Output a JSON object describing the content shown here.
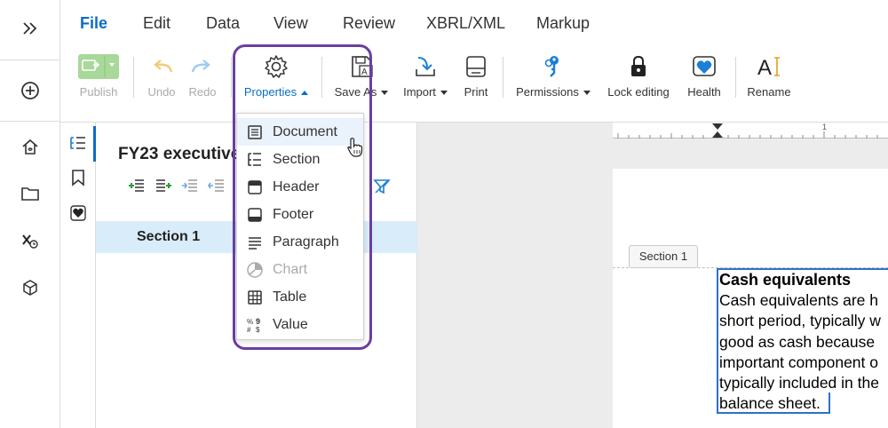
{
  "menu": [
    "File",
    "Edit",
    "Data",
    "View",
    "Review",
    "XBRL/XML",
    "Markup"
  ],
  "active_menu": "File",
  "toolbar": {
    "publish": "Publish",
    "undo": "Undo",
    "redo": "Redo",
    "properties": "Properties",
    "save_as": "Save As",
    "import": "Import",
    "print": "Print",
    "permissions": "Permissions",
    "lock_editing": "Lock editing",
    "health": "Health",
    "rename": "Rename"
  },
  "outline": {
    "title": "FY23 executive",
    "section": "Section 1"
  },
  "properties_menu": {
    "items": [
      "Document",
      "Section",
      "Header",
      "Footer",
      "Paragraph",
      "Chart",
      "Table",
      "Value"
    ],
    "disabled": [
      "Chart"
    ],
    "hovered": "Document"
  },
  "document": {
    "section_tag": "Section 1",
    "heading": "Cash equivalents",
    "lines": [
      "Cash equivalents are h",
      "short period, typically w",
      "good as cash because",
      "important component o",
      "typically included in the",
      "balance sheet."
    ],
    "ruler_mark": "1"
  },
  "colors": {
    "accent": "#0a6cc7",
    "highlight": "#6b3ea0",
    "selection": "#d8ecf9"
  }
}
